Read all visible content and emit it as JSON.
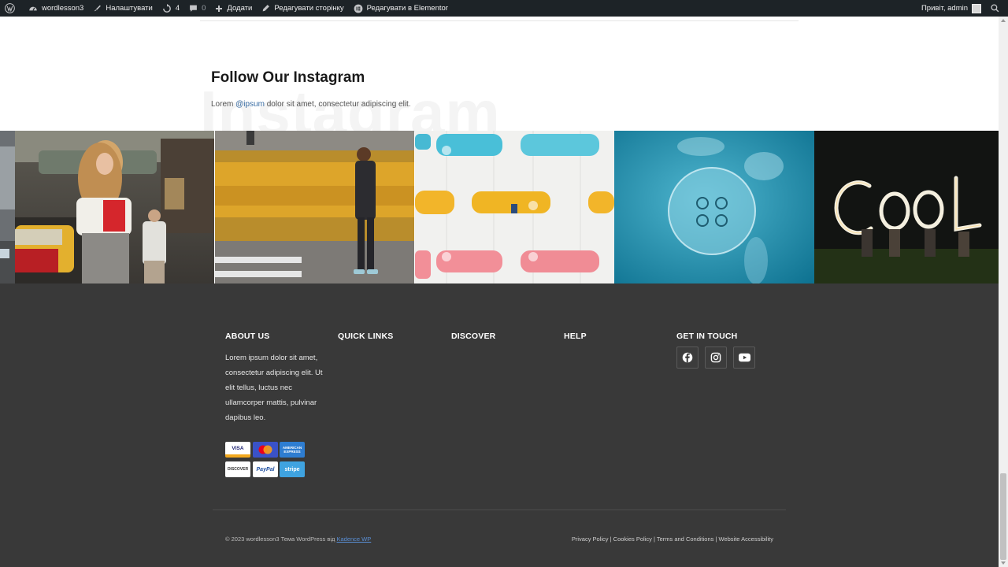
{
  "adminbar": {
    "site_name": "wordlesson3",
    "customize": "Налаштувати",
    "updates_count": "4",
    "comments_count": "0",
    "add_new": "Додати",
    "edit_page": "Редагувати сторінку",
    "edit_elementor": "Редагувати в Elementor",
    "greeting": "Привіт, admin"
  },
  "instagram": {
    "title": "Follow Our Instagram",
    "watermark": "Instagram",
    "subtitle_before": "Lorem ",
    "handle": "@ipsum",
    "subtitle_after": " dolor sit amet, consectetur adipiscing elit."
  },
  "footer": {
    "about_title": "ABOUT US",
    "about_text": "Lorem ipsum dolor sit amet, consectetur adipiscing elit. Ut elit tellus, luctus nec ullamcorper mattis, pulvinar dapibus leo.",
    "quick_links_title": "QUICK LINKS",
    "discover_title": "DISCOVER",
    "help_title": "HELP",
    "contact_title": "GET IN TOUCH",
    "payments": {
      "visa": "VISA",
      "amex": "AMERICAN EXPRESS",
      "discover": "DISCOVER",
      "paypal": "PayPal",
      "stripe": "stripe"
    },
    "copyright_prefix": "© 2023 wordlesson3 Тема WordPress від ",
    "copyright_link": "Kadence WP",
    "legal": {
      "privacy": "Privacy Policy",
      "cookies": "Cookies Policy",
      "terms": "Terms and Conditions",
      "accessibility": "Website Accessibility",
      "separator": " | "
    }
  },
  "colors": {
    "adminbar_bg": "#1d2327",
    "footer_bg": "#393939",
    "link": "#3a6ea5"
  }
}
